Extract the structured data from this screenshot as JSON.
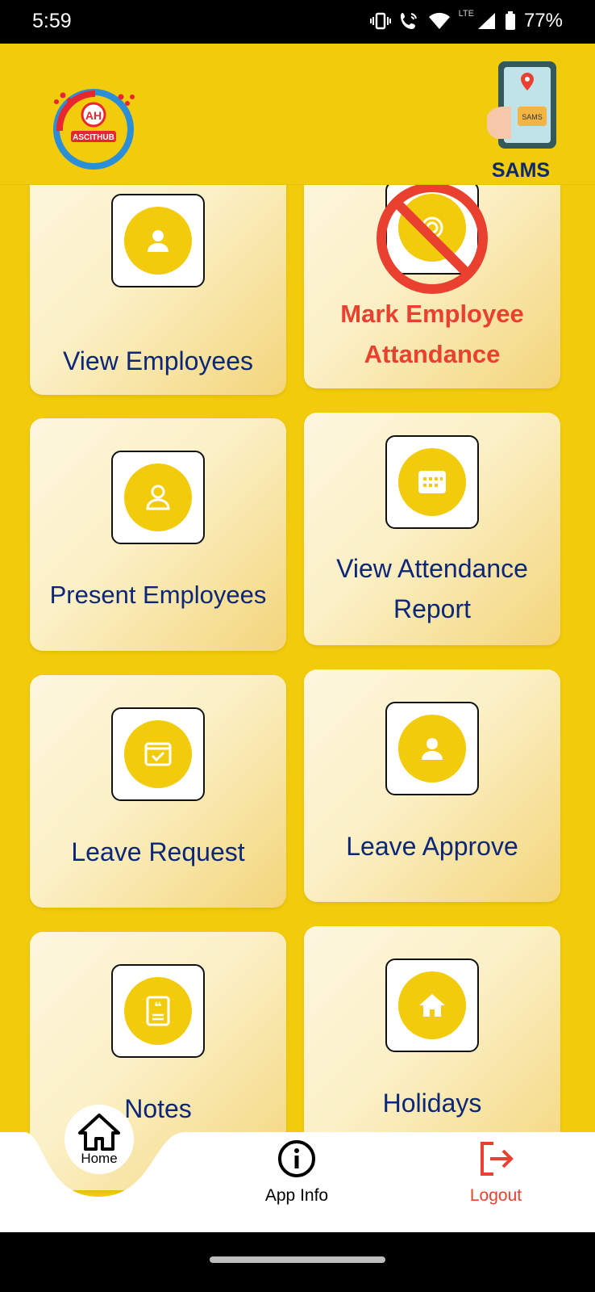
{
  "status_bar": {
    "time": "5:59",
    "network_label": "LTE",
    "battery": "77%"
  },
  "header": {
    "brand_name": "ASCITHUB",
    "app_name": "SAMS",
    "sams_badge": "SAMS"
  },
  "cards": [
    {
      "label": "View Employees",
      "icon": "user-icon"
    },
    {
      "label": "Mark Employee Attandance",
      "icon": "fingerprint-icon",
      "disabled": true
    },
    {
      "label": "Present Employees",
      "icon": "user-outline-icon"
    },
    {
      "label": "View Attendance Report",
      "icon": "calendar-icon"
    },
    {
      "label": "Leave Request",
      "icon": "calendar-check-icon"
    },
    {
      "label": "Leave Approve",
      "icon": "user-icon"
    },
    {
      "label": "Notes",
      "icon": "note-icon"
    },
    {
      "label": "Holidays",
      "icon": "home-icon"
    }
  ],
  "bottom_nav": {
    "home_label": "Home",
    "app_info_label": "App Info",
    "logout_label": "Logout"
  },
  "colors": {
    "background": "#f2cb0c",
    "label_text": "#0c2678",
    "alert": "#e9402f",
    "logout": "#e9402f"
  }
}
